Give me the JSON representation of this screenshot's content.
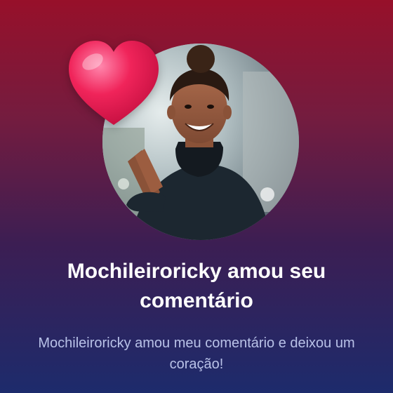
{
  "notification": {
    "title": "Mochileiroricky amou seu comentário",
    "subtitle": "Mochileiroricky amou meu comentário e deixou um coração!",
    "avatar_icon": "user-avatar-photo",
    "reaction_icon": "heart-icon"
  },
  "colors": {
    "gradient_top": "#97102a",
    "gradient_bottom": "#1d2b6c",
    "heart": "#f0245a",
    "title_text": "#ffffff",
    "subtitle_text": "#b9c2e8"
  }
}
